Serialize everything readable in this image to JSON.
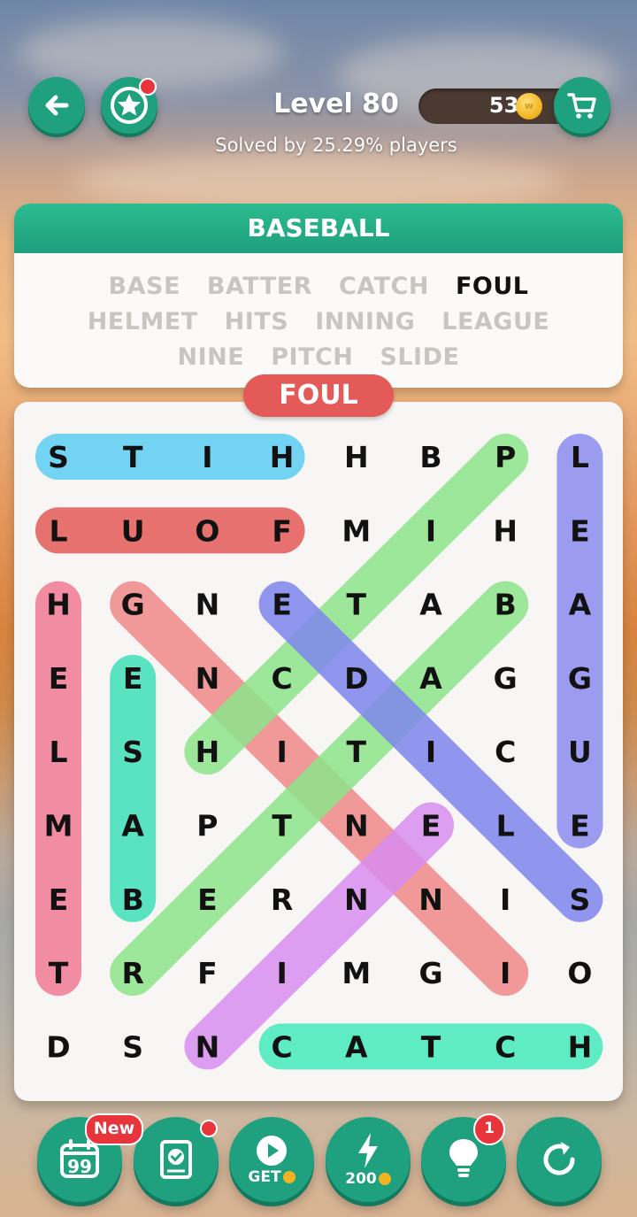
{
  "header": {
    "level_title": "Level 80",
    "solved_text": "Solved by 25.29% players",
    "coins": "533"
  },
  "puzzle": {
    "category": "BASEBALL",
    "current_word": "FOUL",
    "words_row1": [
      {
        "text": "BASE",
        "found": false
      },
      {
        "text": "BATTER",
        "found": false
      },
      {
        "text": "CATCH",
        "found": false
      },
      {
        "text": "FOUL",
        "found": true
      }
    ],
    "words_row2": [
      {
        "text": "HELMET",
        "found": false
      },
      {
        "text": "HITS",
        "found": false
      },
      {
        "text": "INNING",
        "found": false
      },
      {
        "text": "LEAGUE",
        "found": false
      }
    ],
    "words_row3": [
      {
        "text": "NINE",
        "found": false
      },
      {
        "text": "PITCH",
        "found": false
      },
      {
        "text": "SLIDE",
        "found": false
      }
    ],
    "grid": [
      [
        "S",
        "T",
        "I",
        "H",
        "H",
        "B",
        "P",
        "L"
      ],
      [
        "L",
        "U",
        "O",
        "F",
        "M",
        "I",
        "H",
        "E"
      ],
      [
        "H",
        "G",
        "N",
        "E",
        "T",
        "A",
        "B",
        "A"
      ],
      [
        "E",
        "E",
        "N",
        "C",
        "D",
        "A",
        "G",
        "G"
      ],
      [
        "L",
        "S",
        "H",
        "I",
        "T",
        "I",
        "C",
        "U"
      ],
      [
        "M",
        "A",
        "P",
        "T",
        "N",
        "E",
        "L",
        "E"
      ],
      [
        "E",
        "B",
        "E",
        "R",
        "N",
        "N",
        "I",
        "S"
      ],
      [
        "T",
        "R",
        "F",
        "I",
        "M",
        "G",
        "I",
        "O"
      ],
      [
        "D",
        "S",
        "N",
        "C",
        "A",
        "T",
        "C",
        "H"
      ]
    ],
    "highlights": [
      {
        "word": "HITS",
        "from": [
          0,
          3
        ],
        "to": [
          0,
          0
        ],
        "color": "#5bcdf2"
      },
      {
        "word": "FOUL",
        "from": [
          1,
          3
        ],
        "to": [
          1,
          0
        ],
        "color": "#e35a58"
      },
      {
        "word": "HELMET",
        "from": [
          2,
          0
        ],
        "to": [
          7,
          0
        ],
        "color": "#f27a96"
      },
      {
        "word": "BASE",
        "from": [
          6,
          1
        ],
        "to": [
          3,
          1
        ],
        "color": "#3fe0b8"
      },
      {
        "word": "LEAGUE",
        "from": [
          0,
          7
        ],
        "to": [
          5,
          7
        ],
        "color": "#8b8cf0"
      },
      {
        "word": "INNING",
        "from": [
          7,
          6
        ],
        "to": [
          2,
          1
        ],
        "color": "#f08888"
      },
      {
        "word": "PITCH",
        "from": [
          0,
          6
        ],
        "to": [
          4,
          2
        ],
        "color": "#8de58a"
      },
      {
        "word": "BATTER",
        "from": [
          2,
          6
        ],
        "to": [
          7,
          1
        ],
        "color": "#8de58a"
      },
      {
        "word": "SLIDE",
        "from": [
          6,
          7
        ],
        "to": [
          2,
          3
        ],
        "color": "#7f86ee"
      },
      {
        "word": "NINE",
        "from": [
          8,
          2
        ],
        "to": [
          5,
          5
        ],
        "color": "#d98ef0"
      },
      {
        "word": "CATCH",
        "from": [
          8,
          3
        ],
        "to": [
          8,
          7
        ],
        "color": "#45ebbd"
      }
    ],
    "colors": {
      "found_letter": "#ffffff",
      "letter": "#111111"
    }
  },
  "bottom_bar": {
    "daily_badge": "New",
    "video_label": "GET",
    "boost_label": "200",
    "hint_count": "1"
  }
}
